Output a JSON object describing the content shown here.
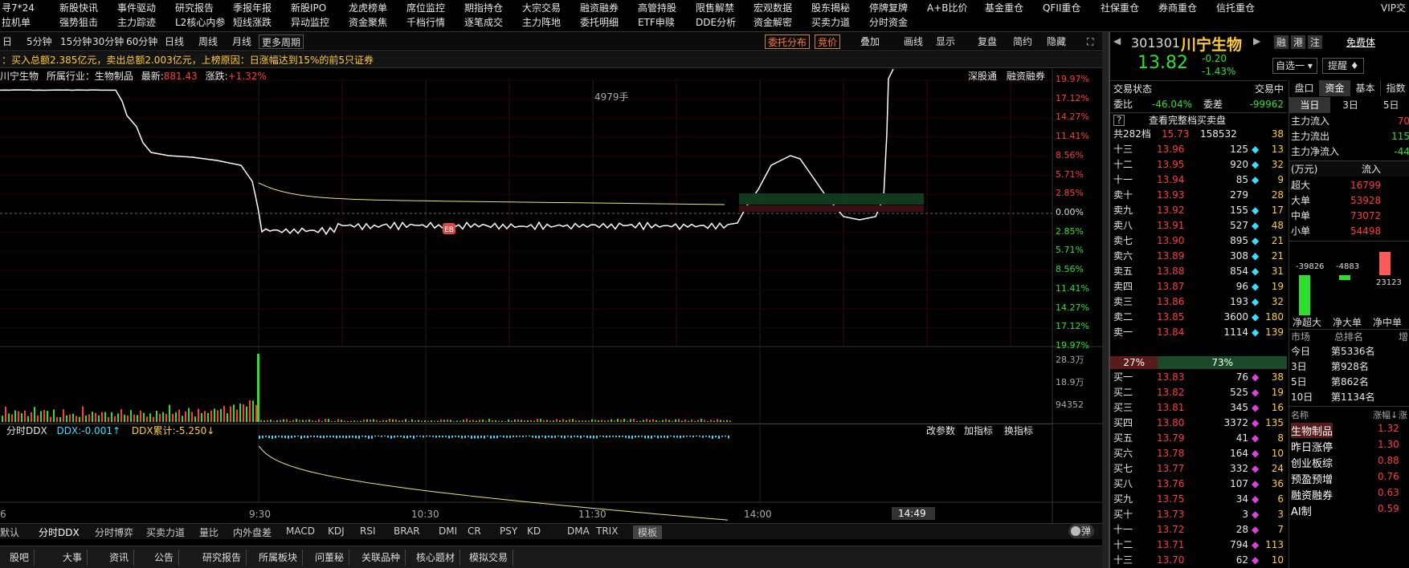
{
  "menu_row1": [
    "寻7*24",
    "新股快讯",
    "事件驱动",
    "研究报告",
    "季报年报",
    "新股IPO",
    "龙虎榜单",
    "席位监控",
    "期指持仓",
    "大宗交易",
    "融资融券",
    "高管持股",
    "限售解禁",
    "宏观数据",
    "股东揭秘",
    "停牌复牌",
    "A+B比价",
    "基金重仓",
    "QFII重仓",
    "社保重仓",
    "券商重仓",
    "信托重仓"
  ],
  "menu_row1_end": "VIP交",
  "menu_row2": [
    "拉机单",
    "强势狙击",
    "主力踪迹",
    "L2核心内参",
    "短线涨跌",
    "异动监控",
    "资金聚焦",
    "千档行情",
    "逐笔成交",
    "主力阵地",
    "委托明细",
    "ETF申赎",
    "DDE分析",
    "资金解密",
    "买卖力道",
    "分时资金"
  ],
  "toolbar": {
    "periods": [
      "日",
      "5分钟",
      "15分钟",
      "30分钟",
      "60分钟",
      "日线",
      "周线",
      "月线",
      "更多周期"
    ],
    "right": {
      "dist": "委托分布",
      "bid": "竞价",
      "overlay": "叠加",
      "draw": "画线",
      "display": "显示",
      "replay": "复盘",
      "simple": "简约",
      "hide": "隐藏"
    }
  },
  "info_bar": "：买入总额2.385亿元，卖出总额2.003亿元，上榜原因：日涨幅达到15%的前5只证券",
  "chart": {
    "stock_label": "川宁生物",
    "industry_label": "所属行业：",
    "industry": "生物制品",
    "latest_label": "最新:",
    "latest": "881.43",
    "chg_label": "涨跌:",
    "chg": "+1.32%",
    "links": [
      "深股通",
      "融资融券"
    ],
    "vol_note": "4979手",
    "pct_labels_up": [
      "19.97%",
      "17.12%",
      "14.27%",
      "11.41%",
      "8.56%",
      "5.71%",
      "2.85%",
      "0.00%"
    ],
    "pct_labels_dn": [
      "2.85%",
      "5.71%",
      "8.56%",
      "11.41%",
      "14.27%",
      "17.12%",
      "19.97%"
    ],
    "vol_labels": [
      "28.3万",
      "18.9万",
      "94352"
    ],
    "time_labels": [
      "6",
      "9:30",
      "10:30",
      "11:30",
      "14:00"
    ],
    "cursor_time": "14:49",
    "ddx": {
      "name": "分时DDX",
      "value": "DDX:-0.001↑",
      "accum": "DDX累计:-5.250↓",
      "btns": [
        "改参数",
        "加指标",
        "换指标"
      ]
    },
    "marker": "EB"
  },
  "chart_data": {
    "type": "line",
    "y_axis": [
      "19.97%",
      "17.12%",
      "14.27%",
      "11.41%",
      "8.56%",
      "5.71%",
      "2.85%",
      "0.00%",
      "2.85%",
      "5.71%",
      "8.56%",
      "11.41%",
      "14.27%",
      "17.12%",
      "19.97%"
    ],
    "x_axis": [
      "9:30",
      "10:30",
      "11:30",
      "14:00",
      "14:49"
    ]
  },
  "bottom_tabs": [
    "默认",
    "分时DDX",
    "分时博弈",
    "买卖力道",
    "量比",
    "内外盘差",
    "MACD",
    "KDJ",
    "RSI",
    "BRAR",
    "DMI",
    "CR",
    "PSY",
    "KD",
    "DMA",
    "TRIX",
    "模板"
  ],
  "bottom_tabs_right": "弹",
  "bottom_tabs2": [
    "股吧",
    "大事",
    "资讯",
    "公告",
    "研究报告",
    "所属板块",
    "问董秘",
    "关联品种",
    "核心题材",
    "模拟交易"
  ],
  "quote": {
    "code": "301301",
    "name": "川宁生物",
    "price": "13.82",
    "change": "-0.20",
    "pct": "-1.43%",
    "tags": [
      "融",
      "港",
      "注"
    ],
    "free": "免费体",
    "selfselect": "自选一",
    "remind": "提醒",
    "status_label": "交易状态",
    "status": "交易中",
    "weibi_label": "委比",
    "weibi": "-46.04%",
    "weicha_label": "委差",
    "weicha": "-99962",
    "fullbook": "查看完整档买卖盘",
    "total_label": "共282档",
    "total_price": "15.73",
    "total_vol": "158532",
    "total_n": "38",
    "ratio_left": "27%",
    "ratio_right": "73%"
  },
  "asks": [
    {
      "lv": "十三",
      "p": "13.96",
      "v": "125",
      "n": "13",
      "d": true
    },
    {
      "lv": "十二",
      "p": "13.95",
      "v": "920",
      "n": "32",
      "d": true
    },
    {
      "lv": "十一",
      "p": "13.94",
      "v": "85",
      "n": "9",
      "d": true
    },
    {
      "lv": "卖十",
      "p": "13.93",
      "v": "279",
      "n": "28",
      "d": false
    },
    {
      "lv": "卖九",
      "p": "13.92",
      "v": "155",
      "n": "17",
      "d": true
    },
    {
      "lv": "卖八",
      "p": "13.91",
      "v": "527",
      "n": "48",
      "d": true
    },
    {
      "lv": "卖七",
      "p": "13.90",
      "v": "895",
      "n": "21",
      "d": true
    },
    {
      "lv": "卖六",
      "p": "13.89",
      "v": "308",
      "n": "21",
      "d": true
    },
    {
      "lv": "卖五",
      "p": "13.88",
      "v": "854",
      "n": "31",
      "d": true
    },
    {
      "lv": "卖四",
      "p": "13.87",
      "v": "96",
      "n": "19",
      "d": true
    },
    {
      "lv": "卖三",
      "p": "13.86",
      "v": "193",
      "n": "32",
      "d": true
    },
    {
      "lv": "卖二",
      "p": "13.85",
      "v": "3600",
      "n": "180",
      "d": true
    },
    {
      "lv": "卖一",
      "p": "13.84",
      "v": "1114",
      "n": "139",
      "d": true
    }
  ],
  "bids": [
    {
      "lv": "买一",
      "p": "13.83",
      "v": "76",
      "n": "38",
      "d": true
    },
    {
      "lv": "买二",
      "p": "13.82",
      "v": "525",
      "n": "19",
      "d": true
    },
    {
      "lv": "买三",
      "p": "13.81",
      "v": "345",
      "n": "16",
      "d": true
    },
    {
      "lv": "买四",
      "p": "13.80",
      "v": "3372",
      "n": "135",
      "d": true
    },
    {
      "lv": "买五",
      "p": "13.79",
      "v": "41",
      "n": "8",
      "d": true
    },
    {
      "lv": "买六",
      "p": "13.78",
      "v": "164",
      "n": "10",
      "d": true
    },
    {
      "lv": "买七",
      "p": "13.77",
      "v": "332",
      "n": "24",
      "d": true
    },
    {
      "lv": "买八",
      "p": "13.76",
      "v": "107",
      "n": "36",
      "d": true
    },
    {
      "lv": "买九",
      "p": "13.75",
      "v": "34",
      "n": "6",
      "d": true
    },
    {
      "lv": "买十",
      "p": "13.73",
      "v": "3",
      "n": "3",
      "d": true
    },
    {
      "lv": "十一",
      "p": "13.72",
      "v": "28",
      "n": "7",
      "d": true
    },
    {
      "lv": "十二",
      "p": "13.71",
      "v": "794",
      "n": "113",
      "d": true
    },
    {
      "lv": "十三",
      "p": "13.70",
      "v": "62",
      "n": "10",
      "d": true
    }
  ],
  "capital": {
    "tabs": [
      "盘口",
      "资金",
      "基本",
      "指数"
    ],
    "subtabs": [
      "当日",
      "3日",
      "5日"
    ],
    "flows": [
      {
        "k": "主力流入",
        "v": "70"
      },
      {
        "k": "主力流出",
        "v": "115"
      },
      {
        "k": "主力净流入",
        "v": "-44"
      }
    ],
    "unit": "(万元)",
    "inflow": "流入",
    "rows": [
      {
        "k": "超大",
        "v": "16799"
      },
      {
        "k": "大单",
        "v": "53928"
      },
      {
        "k": "中单",
        "v": "73072"
      },
      {
        "k": "小单",
        "v": "54498"
      }
    ],
    "bars": [
      "-39826",
      "-4883",
      "23123"
    ],
    "bar_labels": [
      "净超大",
      "净大单",
      "净中单"
    ],
    "rank_head": [
      "市场",
      "总排名",
      "增"
    ],
    "ranks": [
      {
        "k": "今日",
        "v": "第5336名"
      },
      {
        "k": "3日",
        "v": "第928名"
      },
      {
        "k": "5日",
        "v": "第862名"
      },
      {
        "k": "10日",
        "v": "第1134名"
      }
    ],
    "sector_head": [
      "名称",
      "涨幅↓",
      "涨"
    ],
    "sectors": [
      {
        "k": "生物制品",
        "v": "1.32"
      },
      {
        "k": "昨日涨停",
        "v": "1.30"
      },
      {
        "k": "创业板综",
        "v": "0.88"
      },
      {
        "k": "预盈预增",
        "v": "0.76"
      },
      {
        "k": "融资融券",
        "v": "0.63"
      },
      {
        "k": "AI制",
        "v": "0.59"
      }
    ]
  },
  "colors": {
    "up": "#ff3b3b",
    "down": "#2ee02e",
    "accent": "#ffcc33",
    "price_line": "#ffffff",
    "avg_line": "#e6e67a"
  }
}
